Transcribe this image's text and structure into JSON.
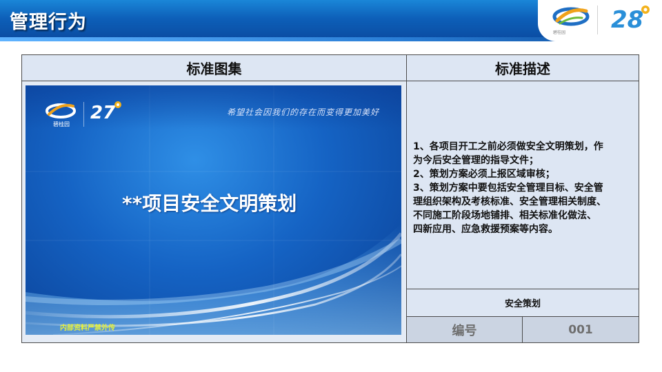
{
  "header": {
    "title": "管理行为",
    "logo_left": "碧桂园",
    "logo_right": "28"
  },
  "table": {
    "col_left_header": "标准图集",
    "col_right_header": "标准描述",
    "description_lines": [
      "1、各项目开工之前必须做安全文明策划，作",
      "为今后安全管理的指导文件；",
      "2、策划方案必须上报区域审核；",
      "3、策划方案中要包括安全管理目标、安全管",
      "理组织架构及考核标准、安全管理相关制度、",
      "不同施工阶段场地铺排、相关标准化做法、",
      "四新应用、应急救援预案等内容。"
    ],
    "category": "安全策划",
    "number_label": "编号",
    "number_value": "001"
  },
  "slide": {
    "title": "**项目安全文明策划",
    "slogan": "希望社会因我们的存在而变得更加美好",
    "footer": "内部资料严禁外传",
    "logo_left": "碧桂园",
    "logo_right": "27"
  },
  "colors": {
    "header_blue": "#0d5fb8",
    "table_fill": "#dde6f3",
    "number_fill": "#cbd4e2",
    "slide_blue": "#1563c4",
    "footer_yellow": "#e8f13a"
  }
}
